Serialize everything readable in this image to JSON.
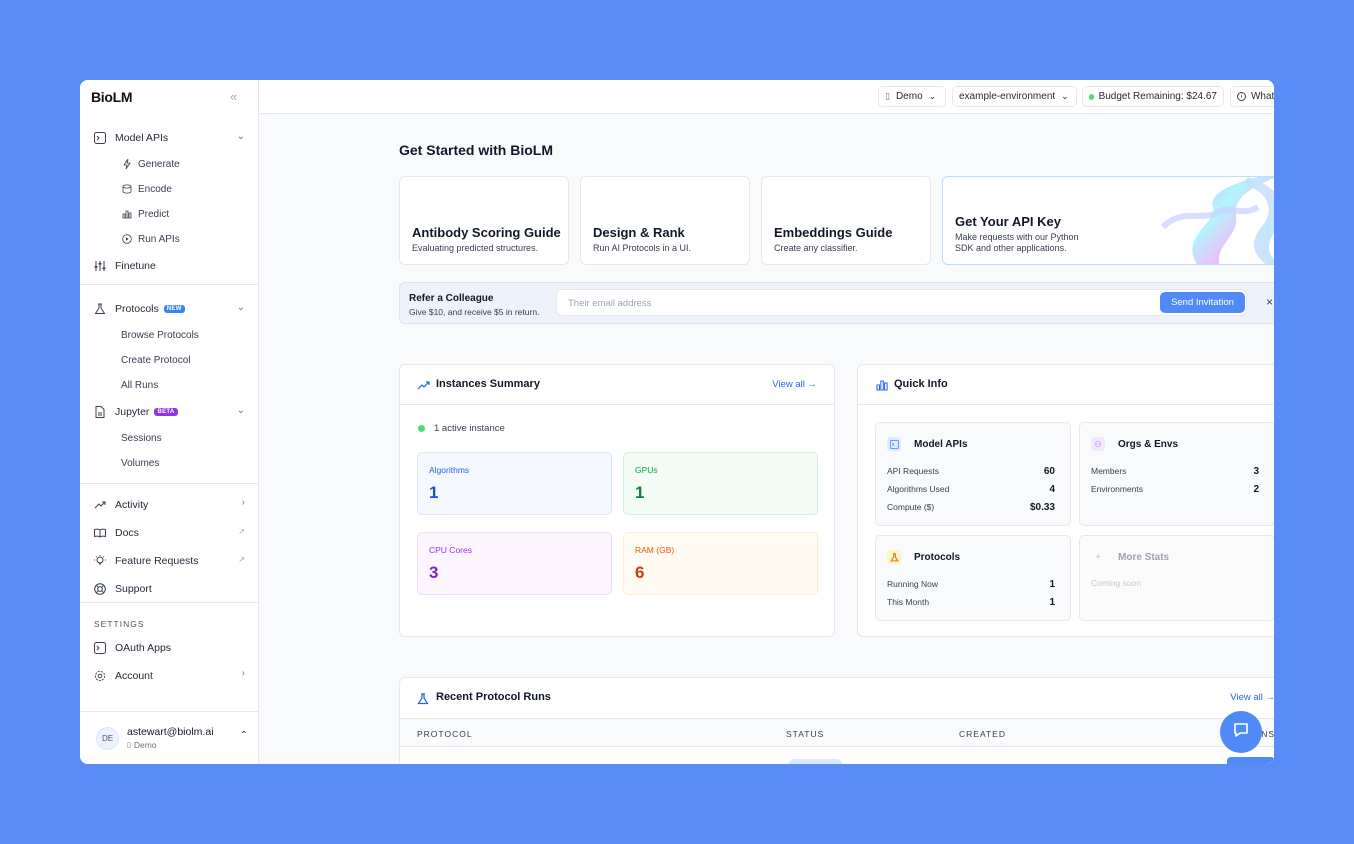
{
  "sidebar": {
    "logo": "BioLM",
    "model_apis": {
      "label": "Model APIs",
      "items": [
        "Generate",
        "Encode",
        "Predict",
        "Run APIs"
      ]
    },
    "finetune": "Finetune",
    "protocols": {
      "label": "Protocols",
      "badge": "NEW",
      "items": [
        "Browse Protocols",
        "Create Protocol",
        "All Runs"
      ]
    },
    "jupyter": {
      "label": "Jupyter",
      "badge": "BETA",
      "items": [
        "Sessions",
        "Volumes"
      ]
    },
    "activity": "Activity",
    "docs": "Docs",
    "feature_requests": "Feature Requests",
    "support": "Support",
    "settings_heading": "SETTINGS",
    "oauth_apps": "OAuth Apps",
    "account": "Account",
    "user": {
      "initials": "DE",
      "email": "astewart@biolm.ai",
      "org": "Demo"
    }
  },
  "topbar": {
    "org": "Demo",
    "environment": "example-environment",
    "budget": "Budget Remaining: $24.67",
    "whats_new": "What's New"
  },
  "get_started": {
    "title": "Get Started with BioLM",
    "cards": [
      {
        "title": "Antibody Scoring Guide",
        "desc": "Evaluating predicted structures."
      },
      {
        "title": "Design & Rank",
        "desc": "Run AI Protocols in a UI."
      },
      {
        "title": "Embeddings Guide",
        "desc": "Create any classifier."
      }
    ],
    "api_card": {
      "title": "Get Your API Key",
      "desc_line1": "Make requests with our Python",
      "desc_line2": "SDK and other applications."
    }
  },
  "referral": {
    "title": "Refer a Colleague",
    "desc": "Give $10, and receive $5 in return.",
    "placeholder": "Their email address",
    "button": "Send Invitation"
  },
  "instances": {
    "title": "Instances Summary",
    "view_all": "View all →",
    "active": "1 active instance",
    "stats": [
      {
        "label": "Algorithms",
        "value": "1",
        "color": "#2563eb"
      },
      {
        "label": "GPUs",
        "value": "1",
        "color": "#16a34a"
      },
      {
        "label": "CPU Cores",
        "value": "3",
        "color": "#9333ea"
      },
      {
        "label": "RAM (GB)",
        "value": "6",
        "color": "#ea580c"
      }
    ]
  },
  "quick_info": {
    "title": "Quick Info",
    "model_apis": {
      "title": "Model APIs",
      "rows": [
        [
          "API Requests",
          "60"
        ],
        [
          "Algorithms Used",
          "4"
        ],
        [
          "Compute ($)",
          "$0.33"
        ]
      ]
    },
    "orgs": {
      "title": "Orgs & Envs",
      "rows": [
        [
          "Members",
          "3"
        ],
        [
          "Environments",
          "2"
        ]
      ]
    },
    "protocols": {
      "title": "Protocols",
      "rows": [
        [
          "Running Now",
          "1"
        ],
        [
          "This Month",
          "1"
        ]
      ]
    },
    "more": {
      "title": "More Stats",
      "desc": "Coming soon"
    }
  },
  "recent_runs": {
    "title": "Recent Protocol Runs",
    "view_all": "View all →",
    "columns": [
      "PROTOCOL",
      "STATUS",
      "CREATED",
      "ACTIONS"
    ]
  }
}
